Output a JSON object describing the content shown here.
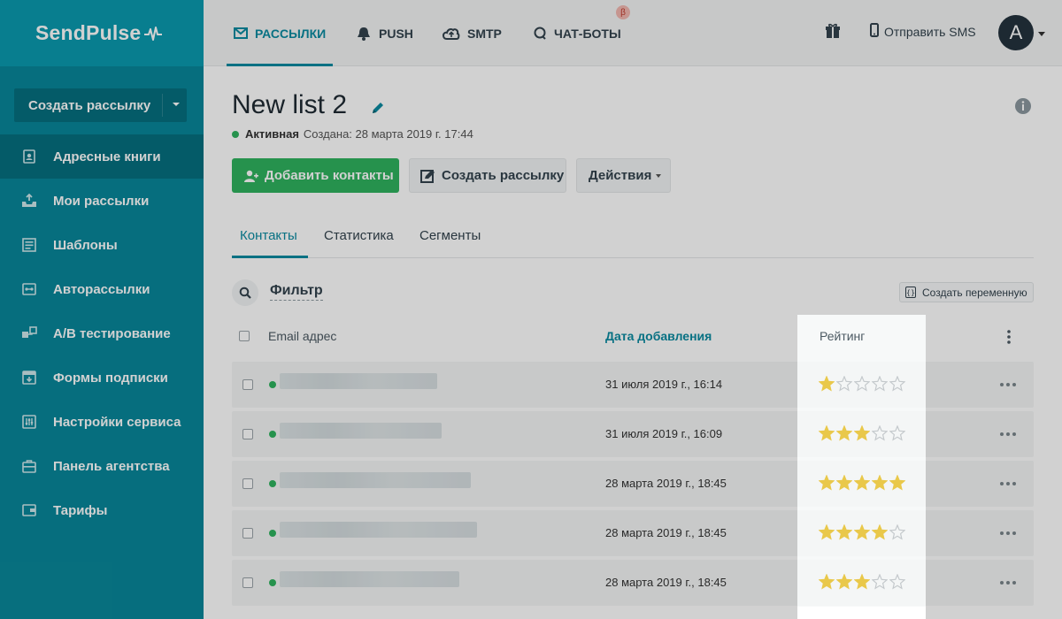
{
  "app": {
    "logo_text": "SendPulse"
  },
  "sidebar": {
    "create_button": "Создать рассылку",
    "items": [
      {
        "label": "Адресные книги",
        "icon": "address-book-icon",
        "active": true
      },
      {
        "label": "Мои рассылки",
        "icon": "campaigns-icon",
        "active": false
      },
      {
        "label": "Шаблоны",
        "icon": "templates-icon",
        "active": false
      },
      {
        "label": "Авторассылки",
        "icon": "automation-icon",
        "active": false
      },
      {
        "label": "A/B тестирование",
        "icon": "ab-test-icon",
        "active": false
      },
      {
        "label": "Формы подписки",
        "icon": "forms-icon",
        "active": false
      },
      {
        "label": "Настройки сервиса",
        "icon": "settings-icon",
        "active": false
      },
      {
        "label": "Панель агентства",
        "icon": "agency-icon",
        "active": false
      },
      {
        "label": "Тарифы",
        "icon": "wallet-icon",
        "active": false
      }
    ]
  },
  "topbar": {
    "tabs": [
      {
        "label": "РАССЫЛКИ",
        "icon": "mail-icon",
        "active": true
      },
      {
        "label": "PUSH",
        "icon": "bell-icon",
        "active": false
      },
      {
        "label": "SMTP",
        "icon": "cloud-icon",
        "active": false
      },
      {
        "label": "ЧАТ-БОТЫ",
        "icon": "chat-icon",
        "active": false
      }
    ],
    "beta_badge": "β",
    "sms_label": "Отправить SMS",
    "avatar_letter": "A"
  },
  "page": {
    "title": "New list 2",
    "status": "Активная",
    "created": "Создана: 28 марта 2019 г. 17:44",
    "buttons": {
      "add_contacts": "Добавить контакты",
      "create_campaign": "Создать рассылку",
      "actions": "Действия"
    },
    "tabs": [
      "Контакты",
      "Статистика",
      "Сегменты"
    ],
    "filter_label": "Фильтр",
    "create_variable": "Создать переменную"
  },
  "table": {
    "columns": {
      "email": "Email адрес",
      "date": "Дата добавления",
      "rating": "Рейтинг"
    },
    "rows": [
      {
        "date": "31 июля 2019 г., 16:14",
        "rating": 1
      },
      {
        "date": "31 июля 2019 г., 16:09",
        "rating": 3
      },
      {
        "date": "28 марта 2019 г., 18:45",
        "rating": 5
      },
      {
        "date": "28 марта 2019 г., 18:45",
        "rating": 4
      },
      {
        "date": "28 марта 2019 г., 18:45",
        "rating": 3
      }
    ]
  },
  "colors": {
    "sidebar": "#08879a",
    "accent": "#0a8aa0",
    "green": "#2fb25e",
    "star_filled": "#e9c84a",
    "star_empty": "#c4c9cc"
  }
}
